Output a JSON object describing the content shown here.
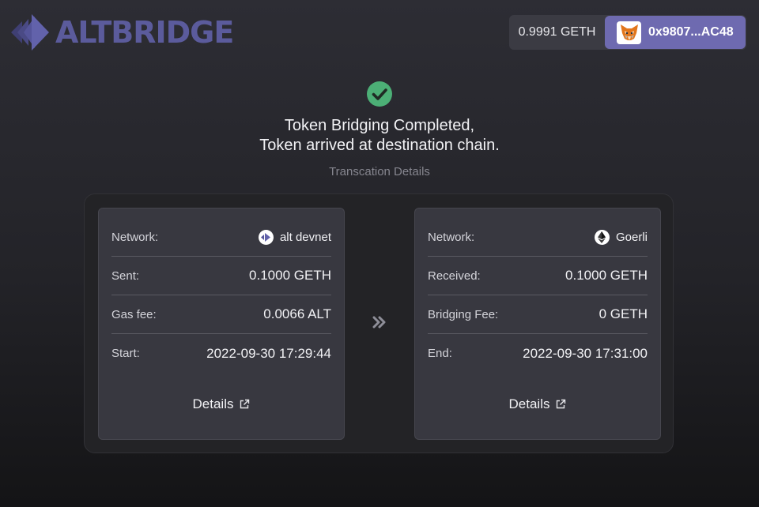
{
  "brand": {
    "name": "ALTBRIDGE",
    "accent": "#6e6ab0"
  },
  "wallet": {
    "balance": "0.9991 GETH",
    "address": "0x9807...AC48",
    "icon": "metamask-fox-icon"
  },
  "status": {
    "icon": "check-circle-icon",
    "icon_color": "#4caf76",
    "line1": "Token Bridging Completed,",
    "line2": "Token arrived at destination chain.",
    "subtitle": "Transcation Details"
  },
  "source": {
    "network_label": "Network:",
    "network": "alt devnet",
    "network_icon": "alt-devnet-icon",
    "amount_label": "Sent:",
    "amount": "0.1000 GETH",
    "fee_label": "Gas fee:",
    "fee": "0.0066 ALT",
    "time_label": "Start:",
    "time": "2022-09-30 17:29:44",
    "details": "Details"
  },
  "destination": {
    "network_label": "Network:",
    "network": "Goerli",
    "network_icon": "ethereum-icon",
    "amount_label": "Received:",
    "amount": "0.1000 GETH",
    "fee_label": "Bridging Fee:",
    "fee": "0 GETH",
    "time_label": "End:",
    "time": "2022-09-30 17:31:00",
    "details": "Details"
  },
  "arrow_icon": "double-chevron-right-icon"
}
